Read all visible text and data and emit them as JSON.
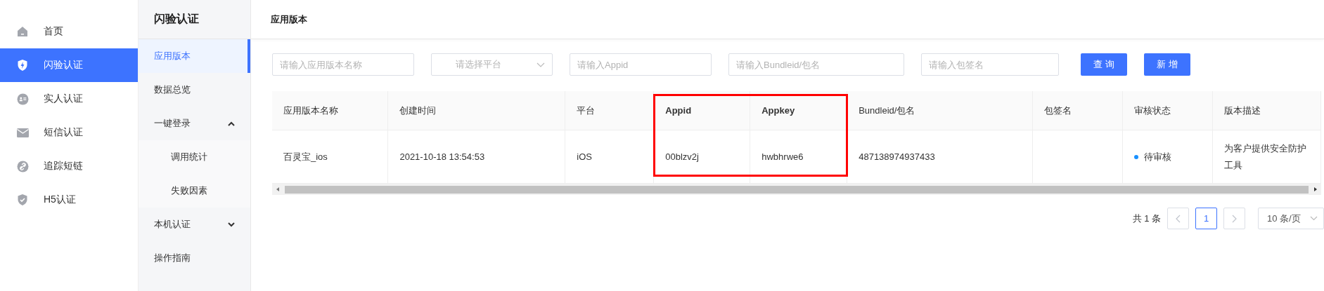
{
  "nav": {
    "items": [
      {
        "label": "首页",
        "kind": "home",
        "selected": false
      },
      {
        "label": "闪验认证",
        "kind": "flash",
        "selected": true
      },
      {
        "label": "实人认证",
        "kind": "person",
        "selected": false
      },
      {
        "label": "短信认证",
        "kind": "mail",
        "selected": false
      },
      {
        "label": "追踪短链",
        "kind": "link",
        "selected": false
      },
      {
        "label": "H5认证",
        "kind": "check",
        "selected": false
      }
    ]
  },
  "subnav": {
    "title": "闪验认证",
    "items": [
      {
        "label": "应用版本",
        "selected": true
      },
      {
        "label": "数据总览",
        "selected": false
      },
      {
        "label": "一键登录",
        "selected": false,
        "expanded": true,
        "children": [
          {
            "label": "调用统计",
            "selected": false
          },
          {
            "label": "失败因素",
            "selected": false
          }
        ]
      },
      {
        "label": "本机认证",
        "selected": false,
        "expanded": false
      },
      {
        "label": "操作指南",
        "selected": false
      }
    ]
  },
  "page": {
    "title": "应用版本"
  },
  "filters": [
    {
      "kind": "input",
      "placeholder": "请输入应用版本名称"
    },
    {
      "kind": "select",
      "placeholder": "请选择平台"
    },
    {
      "kind": "input",
      "placeholder": "请输入Appid"
    },
    {
      "kind": "input",
      "placeholder": "请输入Bundleid/包名"
    },
    {
      "kind": "input",
      "placeholder": "请输入包签名"
    }
  ],
  "buttons": [
    "查 询",
    "新 增"
  ],
  "table": {
    "columns": [
      {
        "label": "应用版本名称",
        "highlighted": false
      },
      {
        "label": "创建时间",
        "highlighted": false
      },
      {
        "label": "平台",
        "highlighted": false
      },
      {
        "label": "Appid",
        "highlighted": true
      },
      {
        "label": "Appkey",
        "highlighted": true
      },
      {
        "label": "Bundleid/包名",
        "highlighted": false
      },
      {
        "label": "包签名",
        "highlighted": false
      },
      {
        "label": "审核状态",
        "highlighted": false
      },
      {
        "label": "版本描述",
        "highlighted": false
      }
    ],
    "rows": [
      {
        "cells": [
          "百灵宝_ios",
          "2021-10-18 13:54:53",
          "iOS",
          "00blzv2j",
          "hwbhrwe6",
          "487138974937433",
          "",
          {
            "kind": "status",
            "text": "待审核",
            "color": "#1890ff"
          },
          "为客户提供安全防护工具"
        ]
      }
    ]
  },
  "pagination": {
    "total": "共 1 条",
    "prev": {
      "disabled": true
    },
    "pages": [
      {
        "label": "1",
        "selected": true
      }
    ],
    "next": {
      "disabled": true
    },
    "page_size": "10 条/页"
  }
}
